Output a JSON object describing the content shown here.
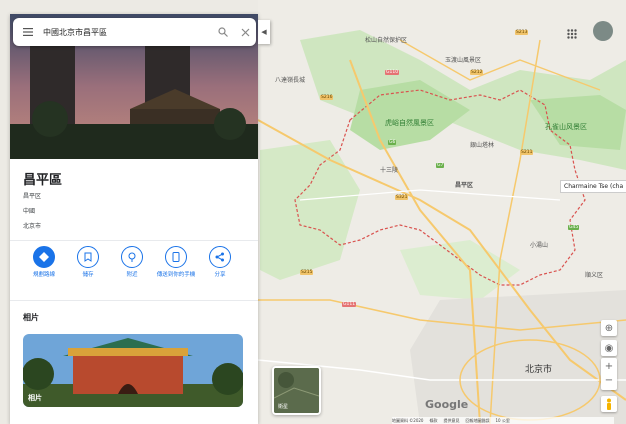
{
  "search": {
    "query": "中國北京市昌平區"
  },
  "place": {
    "title": "昌平區",
    "addr_lines": [
      "昌平区",
      "中國",
      "北京市"
    ]
  },
  "actions": [
    {
      "label": "規劃路線"
    },
    {
      "label": "儲存"
    },
    {
      "label": "附近"
    },
    {
      "label": "傳送到你的手機"
    },
    {
      "label": "分享"
    }
  ],
  "photos": {
    "heading": "相片",
    "photo_label": "相片"
  },
  "map": {
    "labels": [
      {
        "text": "松山自然保护区"
      },
      {
        "text": "八達嶺長城"
      },
      {
        "text": "玉渡山風景区"
      },
      {
        "text": "十三陵"
      },
      {
        "text": "昌平区"
      },
      {
        "text": "銀山塔林"
      },
      {
        "text": "小湯山"
      },
      {
        "text": "北京市"
      },
      {
        "text": "順义区"
      }
    ],
    "parks": [
      {
        "text": "虎峪自然風景区"
      },
      {
        "text": "孔雀山风景区"
      }
    ],
    "roads": [
      "S216",
      "S215",
      "G6",
      "G7",
      "S321",
      "G110",
      "S212",
      "S211",
      "S213",
      "G45",
      "G111"
    ],
    "tooltip": "Charmaine Tse (cha",
    "satellite_label": "衛星",
    "google": "Google",
    "footer": [
      "地圖資料 ©2020",
      "條款",
      "提供意見",
      "回報地圖錯誤",
      "10 公里"
    ]
  },
  "colors": {
    "accent": "#1a73e8",
    "boundary": "#d9534f",
    "park": "#b7dda4",
    "road": "#f6c96d"
  }
}
